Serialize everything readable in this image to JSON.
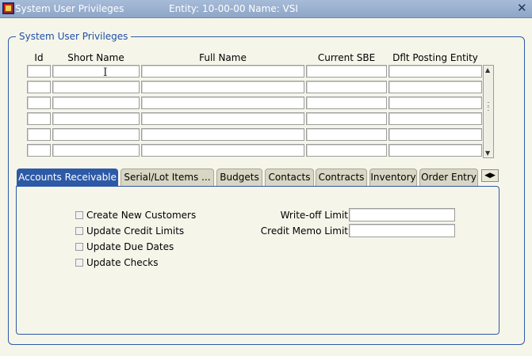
{
  "window": {
    "title": "System User Privileges",
    "entity_text": "Entity: 10-00-00  Name: VSI",
    "close_glyph": "✕"
  },
  "group": {
    "label": "System User Privileges"
  },
  "grid": {
    "columns": [
      "Id",
      "Short Name",
      "Full Name",
      "Current SBE",
      "Dflt Posting Entity"
    ],
    "row_count": 6
  },
  "tabs": [
    {
      "label": "Accounts Receivable",
      "active": true
    },
    {
      "label": "Serial/Lot Items ...",
      "active": false
    },
    {
      "label": "Budgets",
      "active": false
    },
    {
      "label": "Contacts",
      "active": false
    },
    {
      "label": "Contracts",
      "active": false
    },
    {
      "label": "Inventory",
      "active": false
    },
    {
      "label": "Order Entry",
      "active": false
    }
  ],
  "tab_scroll_glyph": "◀▶",
  "panel": {
    "checkboxes": [
      {
        "label": "Create New Customers",
        "checked": false
      },
      {
        "label": "Update Credit Limits",
        "checked": false
      },
      {
        "label": "Update Due Dates",
        "checked": false
      },
      {
        "label": "Update Checks",
        "checked": false
      }
    ],
    "fields": [
      {
        "label": "Write-off Limit",
        "value": ""
      },
      {
        "label": "Credit Memo Limit",
        "value": ""
      }
    ]
  },
  "colors": {
    "accent": "#2d5aa6",
    "titlebar": "#8ea6c7",
    "background": "#f6f5ea"
  }
}
